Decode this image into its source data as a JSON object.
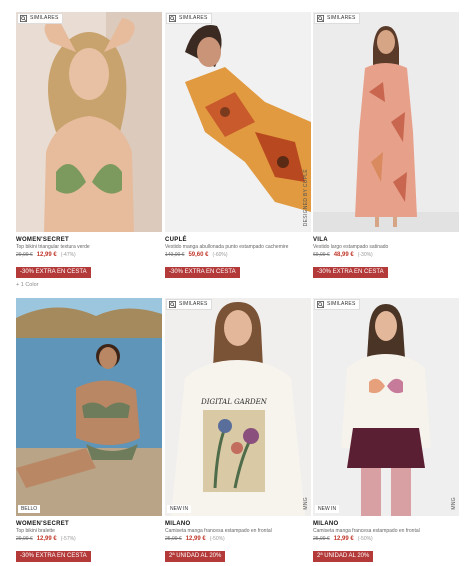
{
  "similar_label": "SIMILARES",
  "products": [
    {
      "brand": "WOMEN'SECRET",
      "desc": "Top bikini triangular textura verde",
      "old": "29,99 €",
      "new": "12,99 €",
      "pct": "(-47%)",
      "promo": "-30% EXTRA EN CESTA",
      "colors": "+ 1 Color"
    },
    {
      "brand": "CUPLÉ",
      "desc": "Vestido manga abullonada punto estampado cachemire",
      "old": "149,00 €",
      "new": "59,60 €",
      "pct": "(-60%)",
      "promo": "-30% EXTRA EN CESTA",
      "side_logo": "DESIGNED BY CUPLÉ"
    },
    {
      "brand": "VILA",
      "desc": "Vestido largo estampado satinado",
      "old": "69,99 €",
      "new": "48,99 €",
      "pct": "(-30%)",
      "promo": "-30% EXTRA EN CESTA"
    },
    {
      "brand": "WOMEN'SECRET",
      "desc": "Top bikini bralette",
      "old": "29,99 €",
      "new": "12,99 €",
      "pct": "(-57%)",
      "promo": "-30% EXTRA EN CESTA",
      "tag": "BELLO"
    },
    {
      "brand": "MILANO",
      "desc": "Camiseta manga francesa estampado en frontal",
      "old": "25,99 €",
      "new": "12,99 €",
      "pct": "(-50%)",
      "promo": "2ª UNIDAD AL 20%",
      "tag": "NEW IN",
      "side_logo": "MNG",
      "shirt_text": "DIGITAL GARDEN"
    },
    {
      "brand": "MILANO",
      "desc": "Camiseta manga francesa estampado en frontal",
      "old": "25,99 €",
      "new": "12,99 €",
      "pct": "(-50%)",
      "promo": "2ª UNIDAD AL 20%",
      "tag": "NEW IN",
      "side_logo": "MNG"
    }
  ]
}
